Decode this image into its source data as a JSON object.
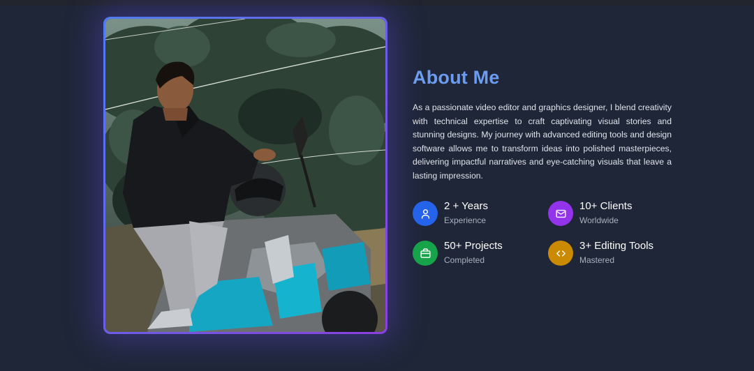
{
  "about": {
    "title": "About Me",
    "paragraph": "As a passionate video editor and graphics designer, I blend creativity with technical expertise to craft captivating visual stories and stunning designs. My journey with advanced editing tools and design software allows me to transform ideas into polished masterpieces, delivering impactful narratives and eye-catching visuals that leave a lasting impression."
  },
  "stats": [
    {
      "value": "2 + Years",
      "label": "Experience",
      "icon": "user-icon",
      "color": "#2563eb"
    },
    {
      "value": "10+ Clients",
      "label": "Worldwide",
      "icon": "mail-icon",
      "color": "#9333ea"
    },
    {
      "value": "50+ Projects",
      "label": "Completed",
      "icon": "briefcase-icon",
      "color": "#16a34a"
    },
    {
      "value": "3+ Editing Tools",
      "label": "Mastered",
      "icon": "code-icon",
      "color": "#ca8a04"
    }
  ],
  "colors": {
    "background": "#1f2638",
    "heading": "#6b9cf0",
    "frame_gradient_start": "#4f7df0",
    "frame_gradient_end": "#8b3fe0"
  }
}
